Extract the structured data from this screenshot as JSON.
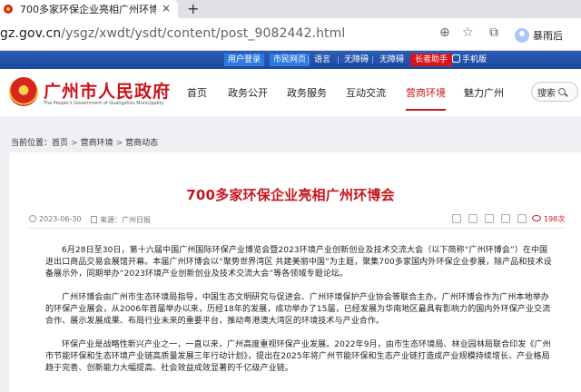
{
  "browser": {
    "tab_title": "700多家环保企业亮相广州环博",
    "tab_close": "×",
    "new_tab": "+",
    "url_host": "gz.gov.cn",
    "url_path": "/ysgz/xwdt/ysdt/content/post_9082442.html",
    "profile_label": "暴雨后"
  },
  "top_strip": {
    "items": [
      "用户登录",
      "市民网页",
      "语言",
      "无障碍",
      "无障碍",
      "长者助手",
      "手机版"
    ],
    "register": "市民网页",
    "login": "用户登录",
    "language": "语言",
    "accessibility": "无障碍",
    "accessibility2": "无障碍",
    "elder": "长者助手",
    "mobile": "手机版"
  },
  "header": {
    "site_title": "广州市人民政府",
    "site_subtitle": "The People's Government of Guangzhou Municipality",
    "nav": [
      "首页",
      "政务公开",
      "政务服务",
      "互动交流",
      "营商环境",
      "魅力广州"
    ],
    "active_nav": "营商环境",
    "search_label": "搜索"
  },
  "breadcrumb": {
    "label": "当前位置：",
    "items": [
      "首页",
      "营商环境",
      "营商动态"
    ],
    "sep": ">"
  },
  "article": {
    "title": "700多家环保企业亮相广州环博会",
    "date": "2023-06-30",
    "source": "来源：广州日报",
    "views": "198次",
    "paragraphs": [
      "6月28日至30日，第十六届中国广州国际环保产业博览会暨2023环境产业创新创业及技术交流大会（以下简称“广州环博会”）在中国进出口商品交易会展馆开幕。本届广州环博会以“聚势世界湾区 共建美丽中国”为主题，聚集700多家国内外环保企业参展，除产品和技术设备展示外，同期举办“2023环境产业创新创业及技术交流大会”等各领域专题论坛。",
      "广州环博会由广州市生态环境局指导，中国生态文明研究与促进会、广州环境保护产业协会等联合主办。广州环博会作为广州本地举办的环保产业展会，从2006年首届举办以来，历经18年的发展，成功举办了15届，已经发展为华南地区最具有影响力的国内外环保产业交流合作、展示发展成果、布局行业未来的重要平台，推动粤港澳大湾区的环境技术与产业合作。",
      "环保产业是战略性新兴产业之一，一直以来，广州高度重视环保产业发展。2022年9月，由市生态环境局、林业园林局联合印发《广州市节能环保和生态环境产业链高质量发展三年行动计划》，提出在2025年将广州节能环保和生态产业链打造成产业规模持续增长、产业格局趋于完善、创新能力大幅提高、社会效益成效显著的千亿级产业链。"
    ]
  }
}
